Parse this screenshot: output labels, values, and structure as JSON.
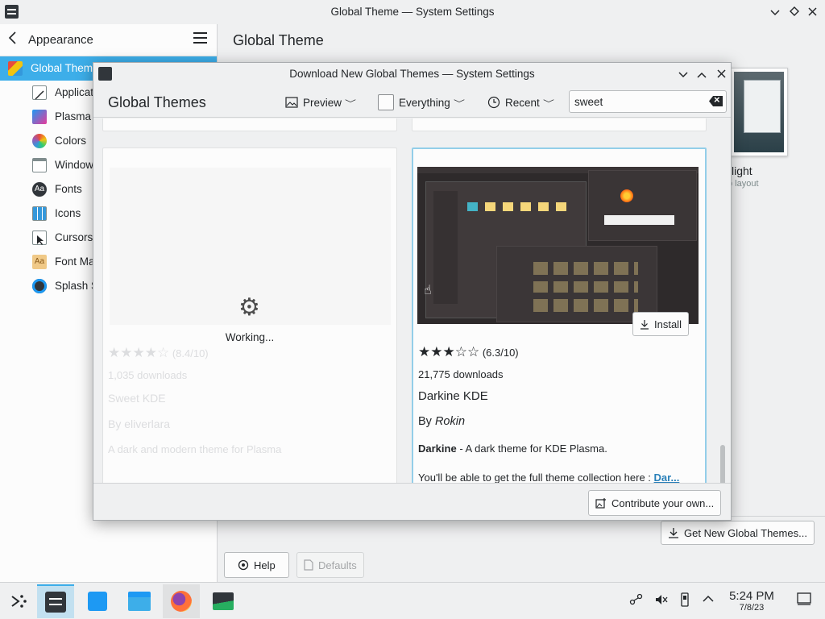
{
  "main_window": {
    "title": "Global Theme — System Settings",
    "sidebar": {
      "back_label": "Appearance",
      "items": [
        {
          "label": "Global Theme",
          "icon": "global-theme-icon",
          "active": true
        },
        {
          "label": "Applicat",
          "icon": "application-style-icon"
        },
        {
          "label": "Plasma",
          "icon": "plasma-style-icon"
        },
        {
          "label": "Colors",
          "icon": "colors-icon"
        },
        {
          "label": "Window",
          "icon": "window-decorations-icon"
        },
        {
          "label": "Fonts",
          "icon": "fonts-icon"
        },
        {
          "label": "Icons",
          "icon": "icons-icon"
        },
        {
          "label": "Cursors",
          "icon": "cursors-icon"
        },
        {
          "label": "Font Ma",
          "icon": "font-management-icon"
        },
        {
          "label": "Splash S",
          "icon": "splash-screen-icon"
        }
      ]
    },
    "content_title": "Global Theme",
    "bg_theme_label": "light",
    "bg_theme_sublabel": "p layout",
    "get_new_button": "Get New Global Themes...",
    "help_button": "Help",
    "defaults_button": "Defaults"
  },
  "dialog": {
    "title": "Download New Global Themes — System Settings",
    "heading": "Global Themes",
    "toolbar": {
      "view_mode": "Preview",
      "filter": "Everything",
      "sort": "Recent"
    },
    "search": {
      "value": "sweet",
      "placeholder": ""
    },
    "cards": {
      "left": {
        "status": "Working...",
        "rating": "(8.4/10)",
        "rating_value": 4,
        "downloads": "1,035 downloads",
        "name": "Sweet KDE",
        "author": "By eliverlara",
        "description": "A dark and modern theme for Plasma"
      },
      "right": {
        "rating": "(6.3/10)",
        "rating_value": 3,
        "downloads": "21,775 downloads",
        "name": "Darkine KDE",
        "author_prefix": "By",
        "author": "Rokin",
        "description_bold": "Darkine",
        "description": " - A dark theme for KDE Plasma.",
        "note": "You'll be able to get the full theme collection here :",
        "note_link": "Dar...",
        "install_button": "Install"
      }
    },
    "contribute_button": "Contribute your own..."
  },
  "taskbar": {
    "apps": [
      "app-launcher-icon",
      "system-settings-icon",
      "discover-icon",
      "dolphin-icon",
      "firefox-icon",
      "system-monitor-icon"
    ],
    "clock_time": "5:24 PM",
    "clock_date": "7/8/23"
  },
  "colors": {
    "accent": "#3daee9",
    "selection_border": "#93cee9",
    "background": "#eff0f1",
    "view": "#fcfcfc"
  }
}
